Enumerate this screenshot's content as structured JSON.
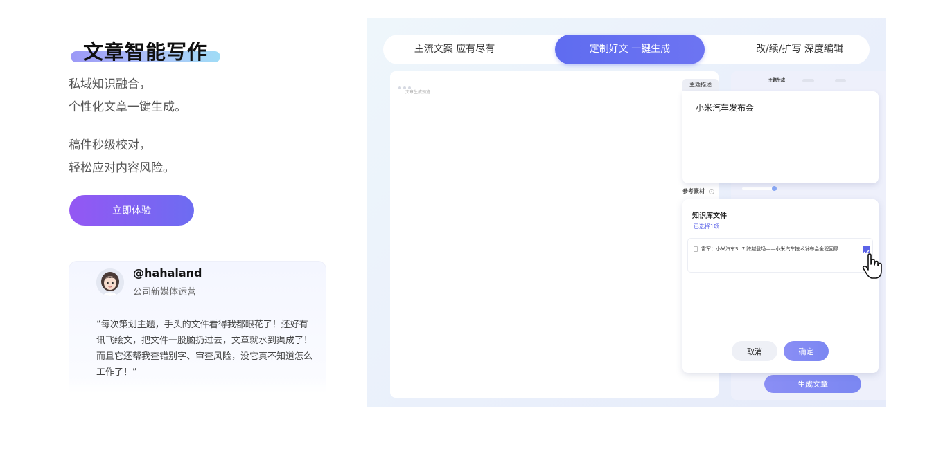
{
  "hero": {
    "title": "文章智能写作",
    "para1_line1": "私域知识融合，",
    "para1_line2": "个性化文章一键生成。",
    "para2_line1": "稿件秒级校对，",
    "para2_line2": "轻松应对内容风险。",
    "cta_label": "立即体验"
  },
  "testimonial": {
    "handle": "@hahaland",
    "role": "公司新媒体运营",
    "quote": "“每次策划主题，手头的文件看得我都眼花了！还好有讯飞绘文，把文件一股脑扔过去，文章就水到渠成了！而且它还帮我查错别字、审查风险，没它真不知道怎么工作了！”"
  },
  "tabs": [
    {
      "label": "主流文案 应有尽有"
    },
    {
      "label": "定制好文 一键生成"
    },
    {
      "label": "改/续/扩写 深度编辑"
    }
  ],
  "app": {
    "doc_label": "文章生成预览",
    "side_active_tab": "主题生成",
    "topic_tab": "主题描述",
    "topic_value": "小米汽车发布会",
    "ref_label": "参考素材",
    "kb_title": "知识库文件",
    "kb_selected": "已选择1项",
    "kb_file": "雷军：小米汽车SU7 跨越登场——小米汽车技术发布会全程回顾",
    "cancel_label": "取消",
    "confirm_label": "确定",
    "generate_label": "生成文章"
  },
  "colors": {
    "accent": "#5f6cf0",
    "cta_start": "#9457f3",
    "cta_end": "#6d6cf2"
  }
}
